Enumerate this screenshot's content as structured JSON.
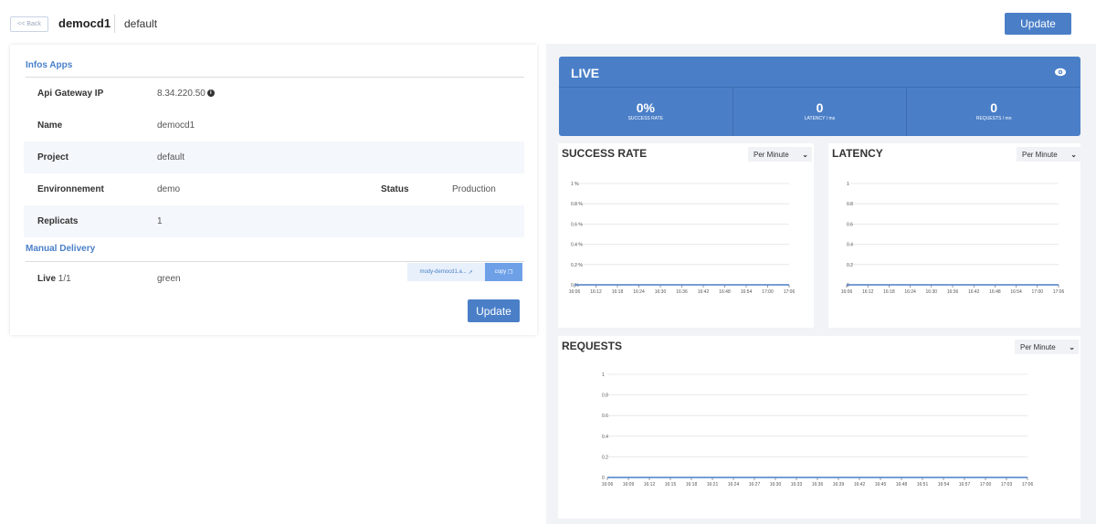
{
  "header": {
    "back_label": "<< Back",
    "app_name": "democd1",
    "project": "default",
    "update_label": "Update"
  },
  "infos": {
    "title": "Infos Apps",
    "rows": [
      {
        "label": "Api Gateway IP",
        "value": "8.34.220.50"
      },
      {
        "label": "Name",
        "value": "democd1"
      },
      {
        "label": "Project",
        "value": "default"
      },
      {
        "label": "Environnement",
        "value": "demo",
        "label2": "Status",
        "value2": "Production"
      },
      {
        "label": "Replicats",
        "value": "1"
      }
    ]
  },
  "delivery": {
    "title": "Manual Delivery",
    "live_label": "Live",
    "live_count": "1/1",
    "color": "green",
    "url_label": "mody-democd1.a...",
    "copy_label": "copy",
    "update_label": "Update"
  },
  "live": {
    "title": "LIVE",
    "success_rate": "0%",
    "success_label": "SUCCESS RATE",
    "latency": "0",
    "latency_label": "LATENCY / ms",
    "requests": "0",
    "requests_label": "REQUESTS / mn"
  },
  "charts": {
    "success": {
      "title": "SUCCESS RATE",
      "select": "Per Minute"
    },
    "latency": {
      "title": "LATENCY",
      "select": "Per Minute"
    },
    "requests": {
      "title": "REQUESTS",
      "select": "Per Minute"
    }
  },
  "chart_data": [
    {
      "type": "line",
      "title": "SUCCESS RATE",
      "x": [
        "16:06",
        "16:12",
        "16:18",
        "16:24",
        "16:30",
        "16:36",
        "16:42",
        "16:48",
        "16:54",
        "17:00",
        "17:06"
      ],
      "yticks": [
        "0 %",
        "0.2 %",
        "0.4 %",
        "0.6 %",
        "0.8 %",
        "1 %"
      ],
      "series": [
        {
          "values": [
            0,
            0,
            0,
            0,
            0,
            0,
            0,
            0,
            0,
            0,
            0
          ]
        }
      ],
      "ylim": [
        0,
        1
      ],
      "color": "#4a7fc8"
    },
    {
      "type": "line",
      "title": "LATENCY",
      "x": [
        "16:06",
        "16:12",
        "16:18",
        "16:24",
        "16:30",
        "16:36",
        "16:42",
        "16:48",
        "16:54",
        "17:00",
        "17:06"
      ],
      "yticks": [
        "0",
        "0.2",
        "0.4",
        "0.6",
        "0.8",
        "1"
      ],
      "series": [
        {
          "values": [
            0,
            0,
            0,
            0,
            0,
            0,
            0,
            0,
            0,
            0,
            0
          ]
        }
      ],
      "ylim": [
        0,
        1
      ],
      "color": "#4a7fc8"
    },
    {
      "type": "line",
      "title": "REQUESTS",
      "x": [
        "16:06",
        "16:09",
        "16:12",
        "16:15",
        "16:18",
        "16:21",
        "16:24",
        "16:27",
        "16:30",
        "16:33",
        "16:36",
        "16:39",
        "16:42",
        "16:45",
        "16:48",
        "16:51",
        "16:54",
        "16:57",
        "17:00",
        "17:03",
        "17:06"
      ],
      "yticks": [
        "0",
        "0.2",
        "0.4",
        "0.6",
        "0.8",
        "1"
      ],
      "series": [
        {
          "values": [
            0,
            0,
            0,
            0,
            0,
            0,
            0,
            0,
            0,
            0,
            0,
            0,
            0,
            0,
            0,
            0,
            0,
            0,
            0,
            0,
            0
          ]
        }
      ],
      "ylim": [
        0,
        1
      ],
      "color": "#4a7fc8"
    }
  ]
}
